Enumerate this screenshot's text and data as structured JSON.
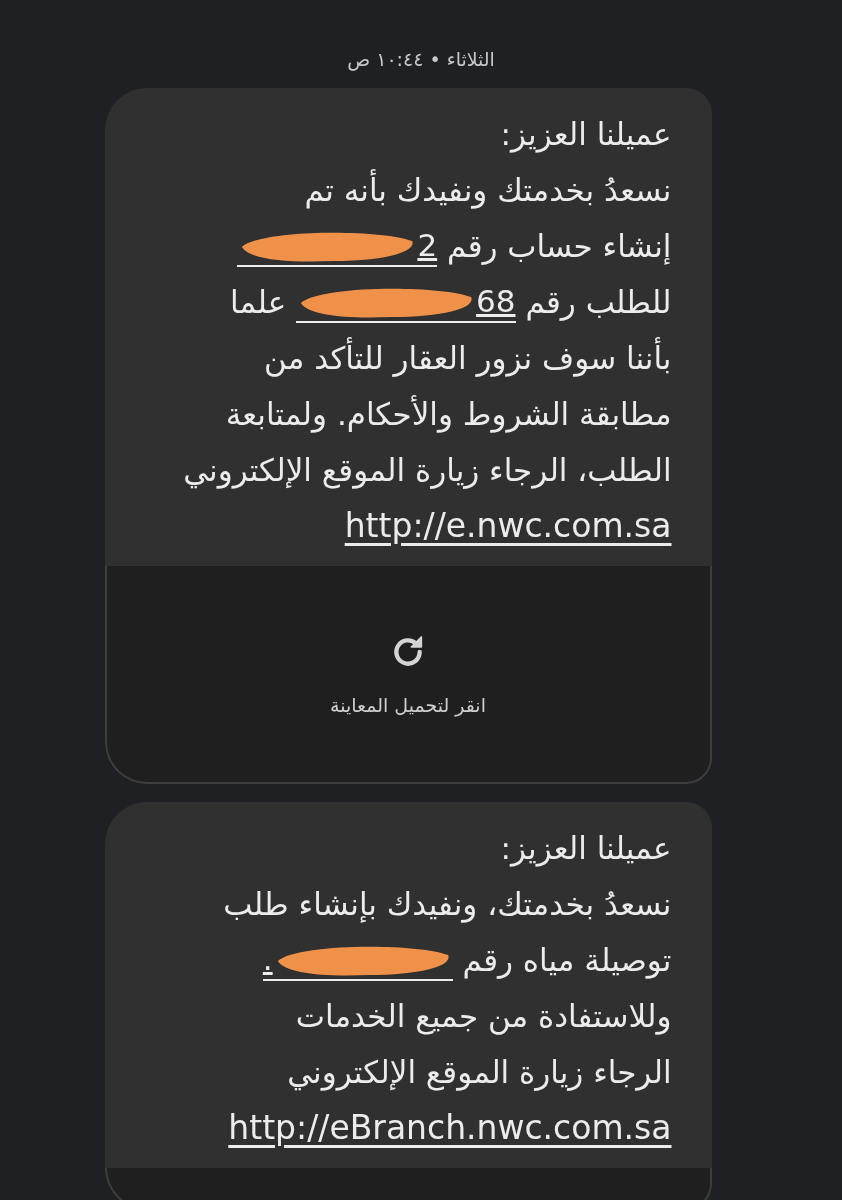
{
  "header": {
    "timestamp": "الثلاثاء • ١٠:٤٤ ص"
  },
  "messages": [
    {
      "has_preview": true,
      "preview_label": "انقر لتحميل المعاينة",
      "lines": [
        [
          {
            "kind": "text",
            "text": "عميلنا العزيز:"
          }
        ],
        [
          {
            "kind": "text",
            "text": "نسعدُ بخدمتك ونفيدك بأنه تم"
          }
        ],
        [
          {
            "kind": "text",
            "text": "إنشاء حساب رقم "
          },
          {
            "kind": "tail_number",
            "visible": "2"
          }
        ],
        [
          {
            "kind": "text",
            "text": "للطلب رقم "
          },
          {
            "kind": "tail_number",
            "visible": "68"
          },
          {
            "kind": "text",
            "text": " علما"
          }
        ],
        [
          {
            "kind": "text",
            "text": "بأننا سوف نزور العقار للتأكد من"
          }
        ],
        [
          {
            "kind": "text",
            "text": "مطابقة الشروط والأحكام. ولمتابعة"
          }
        ],
        [
          {
            "kind": "text",
            "text": "الطلب، الرجاء زيارة الموقع الإلكتروني"
          }
        ],
        [
          {
            "kind": "link",
            "text": "http://e.nwc.com.sa"
          }
        ]
      ]
    },
    {
      "has_preview": true,
      "lines": [
        [
          {
            "kind": "text",
            "text": "عميلنا العزيز:"
          }
        ],
        [
          {
            "kind": "text",
            "text": "نسعدُ بخدمتك، ونفيدك بإنشاء طلب"
          }
        ],
        [
          {
            "kind": "text",
            "text": "توصيلة مياه رقم "
          },
          {
            "kind": "head_number",
            "visible": "."
          }
        ],
        [
          {
            "kind": "text",
            "text": "وللاستفادة من جميع الخدمات"
          }
        ],
        [
          {
            "kind": "text",
            "text": "الرجاء زيارة الموقع الإلكتروني"
          }
        ],
        [
          {
            "kind": "link",
            "text": "http://eBranch.nwc.com.sa"
          }
        ]
      ]
    }
  ]
}
